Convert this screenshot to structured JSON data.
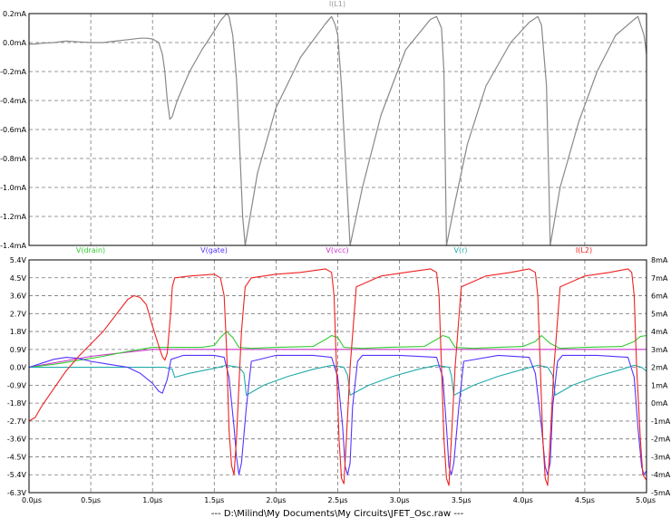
{
  "footer": {
    "title": "---  D:\\Milind\\My Documents\\My Circuits\\JFET_Osc.raw  ---"
  },
  "chart_data": [
    {
      "type": "line",
      "title": "I(L1)",
      "x": [
        0.0,
        0.05,
        0.1,
        0.2,
        0.3,
        0.4,
        0.5,
        0.6,
        0.7,
        0.8,
        0.9,
        0.95,
        1.0,
        1.05,
        1.08,
        1.1,
        1.12,
        1.14,
        1.16,
        1.2,
        1.3,
        1.4,
        1.5,
        1.55,
        1.6,
        1.62,
        1.65,
        1.68,
        1.7,
        1.73,
        1.75,
        1.85,
        2.0,
        2.2,
        2.4,
        2.45,
        2.48,
        2.5,
        2.53,
        2.6,
        2.7,
        2.85,
        3.05,
        3.25,
        3.3,
        3.34,
        3.36,
        3.38,
        3.45,
        3.55,
        3.7,
        3.9,
        4.05,
        4.12,
        4.15,
        4.19,
        4.21,
        4.22,
        4.3,
        4.45,
        4.6,
        4.75,
        4.9,
        4.93,
        4.98,
        5.0
      ],
      "series": [
        {
          "name": "I(L1)",
          "values": [
            -0.01,
            -0.01,
            -0.005,
            0.0,
            0.01,
            0.005,
            0.0,
            0.0,
            0.01,
            0.02,
            0.03,
            0.03,
            0.025,
            0.0,
            -0.08,
            -0.2,
            -0.4,
            -0.53,
            -0.51,
            -0.4,
            -0.2,
            -0.05,
            0.08,
            0.15,
            0.2,
            0.18,
            0.05,
            -0.25,
            -0.6,
            -1.2,
            -1.4,
            -0.9,
            -0.45,
            -0.1,
            0.13,
            0.18,
            0.12,
            0.05,
            -0.3,
            -1.4,
            -1.0,
            -0.5,
            -0.05,
            0.16,
            0.18,
            0.1,
            -0.2,
            -1.4,
            -1.1,
            -0.7,
            -0.3,
            0.0,
            0.14,
            0.18,
            0.12,
            -0.3,
            -1.0,
            -1.4,
            -1.0,
            -0.55,
            -0.2,
            0.05,
            0.16,
            0.18,
            0.05,
            -0.08
          ]
        }
      ],
      "xlim": [
        0.0,
        5.0
      ],
      "ylim": [
        -1.4,
        0.2
      ],
      "y_ticks": [
        "0.2mA",
        "0.0mA",
        "-0.2mA",
        "-0.4mA",
        "-0.6mA",
        "-0.8mA",
        "-1.0mA",
        "-1.2mA",
        "-1.4mA"
      ],
      "colors": {
        "I(L1)": "#888888"
      },
      "grid": true
    },
    {
      "type": "line",
      "legend": [
        "V(drain)",
        "V(gate)",
        "V(vcc)",
        "V(r)",
        "I(L2)"
      ],
      "x_ticks": [
        "0.0µs",
        "0.5µs",
        "1.0µs",
        "1.5µs",
        "2.0µs",
        "2.5µs",
        "3.0µs",
        "3.5µs",
        "4.0µs",
        "4.5µs",
        "5.0µs"
      ],
      "y_ticks_left": [
        "5.4V",
        "4.5V",
        "3.6V",
        "2.7V",
        "1.8V",
        "0.9V",
        "0.0V",
        "-0.9V",
        "-1.8V",
        "-2.7V",
        "-3.6V",
        "-4.5V",
        "-5.4V",
        "-6.3V"
      ],
      "y_ticks_right": [
        "8mA",
        "7mA",
        "6mA",
        "5mA",
        "4mA",
        "3mA",
        "2mA",
        "1mA",
        "0mA",
        "-1mA",
        "-2mA",
        "-3mA",
        "-4mA",
        "-5mA"
      ],
      "xlim": [
        0.0,
        5.0
      ],
      "ylim_left": [
        -6.3,
        5.4
      ],
      "ylim_right": [
        -5,
        8
      ],
      "colors": {
        "V(drain)": "#33cc33",
        "V(gate)": "#5533ff",
        "V(vcc)": "#cc33cc",
        "V(r)": "#22aaaa",
        "I(L2)": "#ee2222"
      },
      "grid": true,
      "series": [
        {
          "name": "V(drain)",
          "axis": "left",
          "x": [
            0.0,
            0.2,
            0.4,
            0.6,
            0.8,
            1.0,
            1.2,
            1.4,
            1.5,
            1.55,
            1.6,
            1.65,
            1.7,
            1.8,
            2.0,
            2.3,
            2.4,
            2.45,
            2.5,
            2.55,
            2.7,
            2.9,
            3.2,
            3.3,
            3.35,
            3.4,
            3.45,
            3.6,
            3.8,
            4.0,
            4.1,
            4.15,
            4.22,
            4.3,
            4.5,
            4.8,
            4.9,
            4.95,
            5.0
          ],
          "values": [
            0.0,
            0.15,
            0.35,
            0.55,
            0.8,
            1.0,
            1.0,
            1.0,
            1.1,
            1.5,
            1.8,
            1.5,
            1.0,
            0.95,
            1.0,
            1.05,
            1.4,
            1.6,
            1.5,
            1.0,
            0.95,
            1.0,
            1.05,
            1.4,
            1.6,
            1.5,
            1.0,
            0.95,
            1.0,
            1.05,
            1.3,
            1.6,
            1.2,
            0.95,
            1.0,
            1.05,
            1.3,
            1.55,
            1.6
          ]
        },
        {
          "name": "V(gate)",
          "axis": "left",
          "x": [
            0.0,
            0.1,
            0.2,
            0.3,
            0.4,
            0.5,
            0.6,
            0.7,
            0.8,
            0.9,
            1.0,
            1.05,
            1.08,
            1.12,
            1.15,
            1.25,
            1.5,
            1.58,
            1.62,
            1.66,
            1.68,
            1.7,
            1.72,
            1.76,
            1.8,
            2.0,
            2.3,
            2.45,
            2.5,
            2.54,
            2.56,
            2.58,
            2.6,
            2.62,
            2.66,
            2.7,
            3.0,
            3.3,
            3.35,
            3.38,
            3.4,
            3.42,
            3.44,
            3.48,
            3.52,
            3.8,
            4.05,
            4.1,
            4.15,
            4.18,
            4.2,
            4.22,
            4.24,
            4.28,
            4.32,
            4.6,
            4.85,
            4.9,
            4.93,
            4.96,
            4.98,
            5.0
          ],
          "values": [
            0.0,
            0.2,
            0.4,
            0.5,
            0.45,
            0.3,
            0.2,
            0.1,
            0.0,
            -0.3,
            -0.8,
            -1.2,
            -1.3,
            -0.6,
            0.4,
            0.6,
            0.6,
            0.5,
            -0.5,
            -3.0,
            -4.5,
            -5.4,
            -4.8,
            -2.0,
            0.3,
            0.6,
            0.6,
            0.5,
            -0.5,
            -3.0,
            -5.0,
            -5.4,
            -4.8,
            -2.0,
            0.3,
            0.6,
            0.6,
            0.5,
            -0.5,
            -3.0,
            -5.0,
            -5.4,
            -4.8,
            -2.0,
            0.3,
            0.6,
            0.5,
            -0.3,
            -3.0,
            -5.0,
            -5.4,
            -4.8,
            -2.0,
            0.3,
            0.6,
            0.6,
            0.5,
            -0.5,
            -3.0,
            -5.0,
            -5.4,
            -5.2
          ]
        },
        {
          "name": "V(vcc)",
          "axis": "left",
          "x": [
            0.0,
            0.5,
            1.0,
            1.5,
            2.0,
            2.5,
            3.0,
            3.5,
            4.0,
            4.5,
            5.0
          ],
          "values": [
            0.0,
            0.55,
            0.9,
            0.9,
            0.9,
            0.9,
            0.9,
            0.9,
            0.9,
            0.9,
            0.9
          ]
        },
        {
          "name": "V(r)",
          "axis": "left",
          "x": [
            0.0,
            0.5,
            1.0,
            1.1,
            1.16,
            1.18,
            1.3,
            1.5,
            1.6,
            1.7,
            1.74,
            1.76,
            1.9,
            2.1,
            2.3,
            2.45,
            2.55,
            2.58,
            2.6,
            2.75,
            2.95,
            3.15,
            3.3,
            3.4,
            3.42,
            3.44,
            3.6,
            3.8,
            4.0,
            4.12,
            4.2,
            4.24,
            4.26,
            4.4,
            4.6,
            4.8,
            4.9,
            4.96,
            5.0
          ],
          "values": [
            0.0,
            0.0,
            0.0,
            0.0,
            -0.1,
            -0.5,
            -0.3,
            -0.05,
            0.1,
            0.0,
            -0.3,
            -1.4,
            -0.9,
            -0.45,
            -0.1,
            0.1,
            0.0,
            -0.4,
            -1.4,
            -0.9,
            -0.45,
            -0.1,
            0.1,
            0.0,
            -0.4,
            -1.4,
            -0.9,
            -0.45,
            -0.1,
            0.1,
            0.0,
            -0.4,
            -1.4,
            -0.9,
            -0.45,
            -0.1,
            0.1,
            0.0,
            -0.2
          ]
        },
        {
          "name": "I(L2)",
          "axis": "right",
          "x": [
            0.0,
            0.05,
            0.1,
            0.2,
            0.3,
            0.4,
            0.5,
            0.6,
            0.7,
            0.8,
            0.85,
            0.9,
            0.95,
            1.0,
            1.05,
            1.08,
            1.1,
            1.12,
            1.15,
            1.16,
            1.18,
            1.3,
            1.5,
            1.55,
            1.58,
            1.6,
            1.62,
            1.64,
            1.66,
            1.68,
            1.7,
            1.72,
            1.75,
            1.8,
            2.0,
            2.2,
            2.4,
            2.45,
            2.47,
            2.49,
            2.51,
            2.53,
            2.55,
            2.57,
            2.6,
            2.65,
            2.85,
            3.05,
            3.25,
            3.3,
            3.32,
            3.34,
            3.36,
            3.38,
            3.4,
            3.42,
            3.45,
            3.5,
            3.7,
            3.9,
            4.05,
            4.1,
            4.12,
            4.14,
            4.16,
            4.18,
            4.2,
            4.22,
            4.25,
            4.3,
            4.5,
            4.7,
            4.85,
            4.88,
            4.9,
            4.92,
            4.95,
            4.97,
            5.0
          ],
          "values": [
            -1.0,
            -0.8,
            -0.2,
            0.8,
            1.8,
            2.6,
            3.3,
            4.0,
            4.9,
            5.8,
            6.0,
            5.9,
            5.5,
            4.3,
            3.2,
            2.6,
            2.4,
            2.8,
            5.3,
            6.5,
            7.0,
            7.1,
            7.2,
            7.0,
            6.0,
            3.0,
            -1.5,
            -3.5,
            -4.0,
            -2.0,
            1.0,
            4.0,
            6.5,
            7.0,
            7.2,
            7.3,
            7.5,
            7.3,
            6.0,
            2.0,
            -2.0,
            -4.2,
            -4.5,
            -2.0,
            2.0,
            6.5,
            7.1,
            7.3,
            7.5,
            7.3,
            6.0,
            2.0,
            -2.0,
            -4.2,
            -4.6,
            -2.0,
            2.0,
            6.5,
            7.1,
            7.3,
            7.5,
            7.3,
            6.0,
            2.0,
            -2.0,
            -4.2,
            -4.6,
            -2.0,
            2.0,
            6.5,
            7.1,
            7.3,
            7.5,
            7.3,
            6.0,
            2.0,
            -2.0,
            -4.0,
            -4.3
          ]
        }
      ]
    }
  ]
}
